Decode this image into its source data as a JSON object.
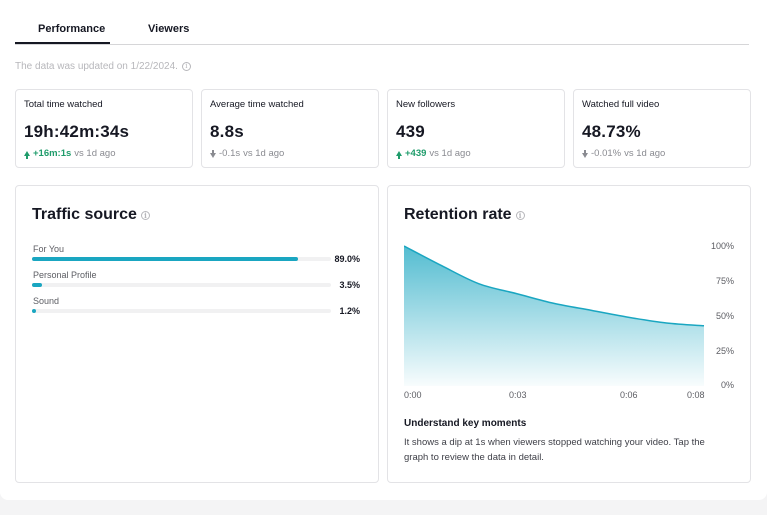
{
  "tabs": [
    {
      "label": "Performance",
      "active": true
    },
    {
      "label": "Viewers",
      "active": false
    }
  ],
  "updated_text": "The data was updated on 1/22/2024.",
  "stats": [
    {
      "label": "Total time watched",
      "value": "19h:42m:34s",
      "delta": "+16m:1s",
      "suffix": "vs 1d ago",
      "direction": "up"
    },
    {
      "label": "Average time watched",
      "value": "8.8s",
      "delta": "-0.1s",
      "suffix": "vs 1d ago",
      "direction": "down"
    },
    {
      "label": "New followers",
      "value": "439",
      "delta": "+439",
      "suffix": "vs 1d ago",
      "direction": "up"
    },
    {
      "label": "Watched full video",
      "value": "48.73%",
      "delta": "-0.01%",
      "suffix": "vs 1d ago",
      "direction": "down"
    }
  ],
  "traffic_source": {
    "title": "Traffic source",
    "rows": [
      {
        "label": "For You",
        "percent": 89.0,
        "display": "89.0%"
      },
      {
        "label": "Personal Profile",
        "percent": 3.5,
        "display": "3.5%"
      },
      {
        "label": "Sound",
        "percent": 1.2,
        "display": "1.2%"
      }
    ],
    "bar_color": "#1aa6c1"
  },
  "retention": {
    "title": "Retention rate",
    "y_ticks": [
      "100%",
      "75%",
      "50%",
      "25%",
      "0%"
    ],
    "x_ticks": [
      "0:00",
      "0:03",
      "0:06",
      "0:08"
    ],
    "key_moments_title": "Understand key moments",
    "key_moments_text": "It shows a dip at 1s when viewers stopped watching your video. Tap the graph to review the data in detail.",
    "line_color": "#1aa6c1"
  },
  "chart_data": {
    "type": "area",
    "title": "Retention rate",
    "xlabel": "",
    "ylabel": "",
    "x_ticks": [
      "0:00",
      "0:03",
      "0:06",
      "0:08"
    ],
    "x": [
      0,
      1,
      2,
      3,
      4,
      5,
      6,
      7,
      8
    ],
    "values": [
      100,
      86,
      73,
      66,
      59,
      54,
      49,
      45,
      43
    ],
    "xlim": [
      0,
      8
    ],
    "ylim": [
      0,
      100
    ],
    "grid": false
  }
}
